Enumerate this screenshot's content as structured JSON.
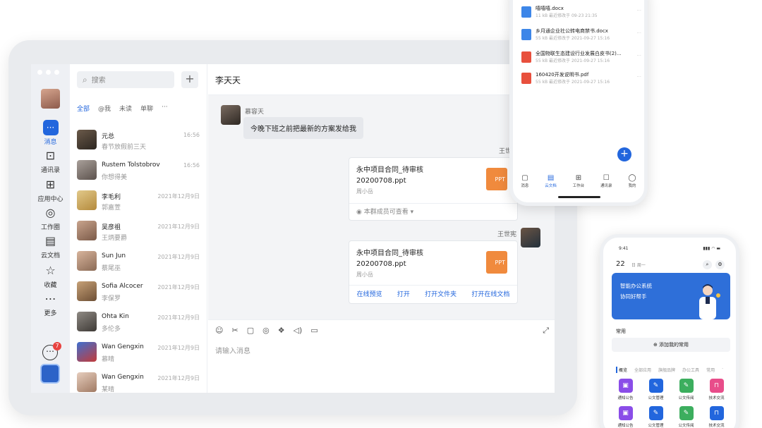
{
  "desktop": {
    "sidebar": {
      "items": [
        {
          "label": "消息",
          "icon": "message-icon",
          "active": true
        },
        {
          "label": "通讯录",
          "icon": "contacts-icon"
        },
        {
          "label": "应用中心",
          "icon": "apps-icon"
        },
        {
          "label": "工作圈",
          "icon": "compass-icon"
        },
        {
          "label": "云文档",
          "icon": "cloud-doc-icon"
        },
        {
          "label": "收藏",
          "icon": "star-icon"
        },
        {
          "label": "更多",
          "icon": "more-icon"
        }
      ],
      "badge_count": "7"
    },
    "search": {
      "placeholder": "搜索",
      "add_label": "+"
    },
    "filters": [
      "全部",
      "@我",
      "未读",
      "单聊",
      "···"
    ],
    "conversations": [
      {
        "name": "元总",
        "preview": "春节放假前三天",
        "time": "16:56"
      },
      {
        "name": "Rustem Tolstobrov",
        "preview": "你想得美",
        "time": "16:56"
      },
      {
        "name": "李毛利",
        "preview": "郭嘉萱",
        "time": "2021年12月9日"
      },
      {
        "name": "吴彦祖",
        "preview": "王炳要爵",
        "time": "2021年12月9日"
      },
      {
        "name": "Sun Jun",
        "preview": "蔡尾巫",
        "time": "2021年12月9日"
      },
      {
        "name": "Sofia Alcocer",
        "preview": "李保罗",
        "time": "2021年12月9日"
      },
      {
        "name": "Ohta Kin",
        "preview": "多伦多",
        "time": "2021年12月9日"
      },
      {
        "name": "Wan Gengxin",
        "preview": "慕晴",
        "time": "2021年12月9日"
      },
      {
        "name": "Wan Gengxin",
        "preview": "某晴",
        "time": "2021年12月9日"
      }
    ],
    "chat": {
      "title": "李天天",
      "messages": {
        "m1_sender": "慕容天",
        "m1_text": "今晚下班之前把最新的方案发给我",
        "m2_sender": "王世",
        "m3_sender": "王世宪"
      },
      "file1": {
        "name_line1": "永中项目合同_待审核",
        "name_line2": "20200708.ppt",
        "owner": "周小岳",
        "badge": "PPT",
        "footer": "◉ 本群成员可查看 ▾"
      },
      "file2": {
        "name_line1": "永中项目合同_待审核",
        "name_line2": "20200708.ppt",
        "owner": "周小岳",
        "badge": "PPT",
        "actions": [
          "在线预览",
          "打开",
          "打开文件夹",
          "打开在线文档"
        ]
      },
      "composer": {
        "placeholder": "请输入消息",
        "tools": [
          "☺",
          "✂",
          "▢",
          "◎",
          "❖",
          "◁)",
          "▭"
        ],
        "expand": "⤢"
      }
    }
  },
  "phone_docs": {
    "docs": [
      {
        "name": "嘻嘻嘻.docx",
        "meta": "11 kB  最近修改于 09-23 21:35",
        "color": "#3d86e8"
      },
      {
        "name": "乡月通企业社公转电商禁书.docx",
        "meta": "55 kB  最近修改于 2021-09-27 15:16",
        "color": "#3d86e8"
      },
      {
        "name": "全国物联生态建设行业发展白皮书(2)...",
        "meta": "55 kB  最近修改于 2021-09-27 15:16",
        "color": "#e8503d"
      },
      {
        "name": "160420开发说明书.pdf",
        "meta": "55 kB  最近修改于 2021-09-27 15:16",
        "color": "#e8503d"
      }
    ],
    "fab": "+",
    "tabs": [
      {
        "label": "消息",
        "icon": "▢"
      },
      {
        "label": "云文档",
        "icon": "▤",
        "active": true
      },
      {
        "label": "工作台",
        "icon": "⊞"
      },
      {
        "label": "通讯录",
        "icon": "☐"
      },
      {
        "label": "我的",
        "icon": "◯"
      }
    ]
  },
  "phone_work": {
    "status_time": "9:41",
    "status_icons": "▮▮▮ ◠ ▬",
    "date": "22",
    "weekday": "日  周一",
    "banner_line1": "智能办公系统",
    "banner_line2": "协同好帮手",
    "section_title": "常用",
    "add_common": "⊕ 添加我的常用",
    "categories": [
      "概览",
      "全部应用",
      "旗舰品牌",
      "办公工具",
      "常用",
      "·"
    ],
    "apps": [
      {
        "label": "通知公告",
        "color": "#8a4de8"
      },
      {
        "label": "公文管理",
        "color": "#2266dd"
      },
      {
        "label": "公文传阅",
        "color": "#3cae5e"
      },
      {
        "label": "技术交流",
        "color": "#e84d8a"
      },
      {
        "label": "通知公告",
        "color": "#8a4de8"
      },
      {
        "label": "公文管理",
        "color": "#2266dd"
      },
      {
        "label": "公文传阅",
        "color": "#3cae5e"
      },
      {
        "label": "技术交流",
        "color": "#2266dd"
      }
    ]
  }
}
